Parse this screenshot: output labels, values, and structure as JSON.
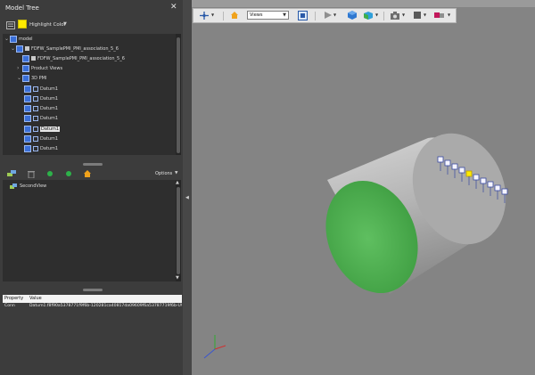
{
  "panel": {
    "title": "Model Tree",
    "highlight_label": "Highlight Color",
    "close_glyph": "✕"
  },
  "tree": {
    "items": [
      {
        "label": "model",
        "expander": "⌄"
      },
      {
        "label": "FDFW_SamplePMI_PMI_association_5_6",
        "expander": "⌄"
      },
      {
        "label": "FDFW_SamplePMI_PMI_association_5_6",
        "expander": ""
      },
      {
        "label": "Product Views",
        "expander": "›"
      },
      {
        "label": "3D PMI",
        "expander": "⌄"
      },
      {
        "label": "Datum1",
        "expander": ""
      },
      {
        "label": "Datum1",
        "expander": ""
      },
      {
        "label": "Datum1",
        "expander": ""
      },
      {
        "label": "Datum1",
        "expander": ""
      },
      {
        "label": "Datum1",
        "expander": "",
        "selected": true
      },
      {
        "label": "Datum1",
        "expander": ""
      },
      {
        "label": "Datum1",
        "expander": ""
      }
    ]
  },
  "views_toolbar": {
    "options_label": "Options"
  },
  "views": {
    "items": [
      {
        "label": "SecondView"
      }
    ]
  },
  "properties": {
    "header": {
      "property": "Property",
      "value": "Value"
    },
    "rows": [
      {
        "property": "Conn",
        "value": "Datum1.f8f90a5378771f9f6b-120281ca40817da09609f6a53787719f6b-U92"
      }
    ]
  },
  "viewport_toolbar": {
    "views_dropdown": "Views",
    "icons": [
      "axis-gizmo-icon",
      "home-icon",
      "fit-view-icon",
      "play-icon",
      "solid-cube-icon",
      "shaded-cube-icon",
      "camera-icon",
      "render-mode-icon",
      "explode-icon"
    ]
  },
  "colors": {
    "panel_bg": "#3c3c3c",
    "tree_bg": "#2e2e2e",
    "viewport_bg": "#848484",
    "cylinder_face": "#4caf50",
    "cylinder_body": "#b9b9b9",
    "checkbox_blue": "#3a6fd8",
    "highlight_yellow": "#ffea00"
  }
}
